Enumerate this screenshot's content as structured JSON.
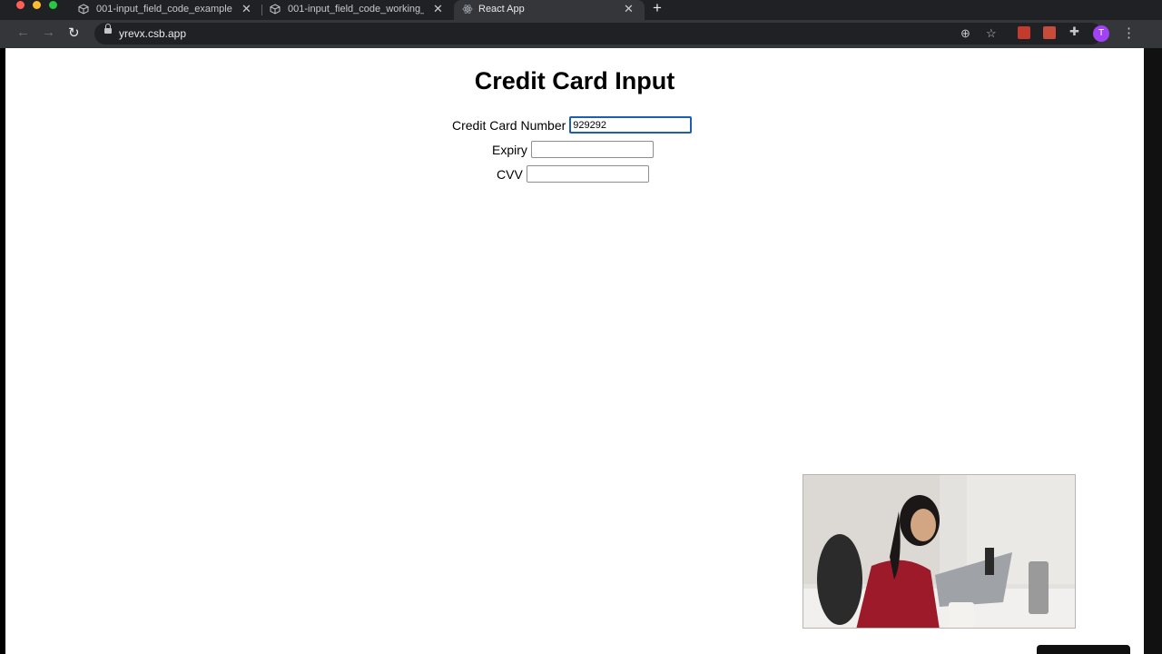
{
  "browser": {
    "tabs": [
      {
        "label": "001-input_field_code_example",
        "active": false
      },
      {
        "label": "001-input_field_code_working_",
        "active": false
      },
      {
        "label": "React App",
        "active": true
      }
    ],
    "url": "yrevx.csb.app",
    "profile_initial": "T",
    "colors": {
      "tabstrip": "#202124",
      "toolbar": "#35363a",
      "avatar": "#a142f4"
    }
  },
  "page": {
    "title": "Credit Card Input",
    "fields": [
      {
        "label": "Credit Card Number",
        "value": "929292",
        "focused": true
      },
      {
        "label": "Expiry",
        "value": "",
        "focused": false
      },
      {
        "label": "CVV",
        "value": "",
        "focused": false
      }
    ]
  },
  "icons": {
    "back": "arrow-left-icon",
    "forward": "arrow-right-icon",
    "reload": "reload-icon",
    "install": "install-icon",
    "bookmark": "star-icon",
    "extensions": "puzzle-icon",
    "menu": "kebab-icon"
  }
}
